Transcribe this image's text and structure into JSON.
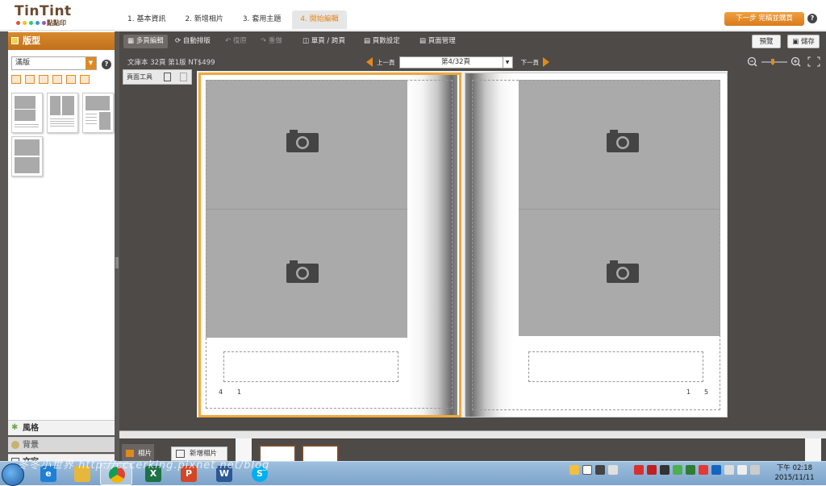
{
  "brand": {
    "name": "TinTint",
    "sub": "點點印",
    "dot_colors": [
      "#e74c3c",
      "#f1c40f",
      "#2ecc71",
      "#3498db",
      "#9b59b6"
    ]
  },
  "steps": [
    "1. 基本資訊",
    "2. 新增相片",
    "3. 套用主題",
    "4. 開始編輯"
  ],
  "active_step": 3,
  "next_button": "下一步 完稿並購買",
  "help": "?",
  "toolbar": {
    "multi_page": "多頁編輯",
    "auto_layout": "自動排版",
    "undo": "復原",
    "redo": "重做",
    "single_double": "單頁 / 跨頁",
    "page_settings": "頁數設定",
    "page_manage": "頁面管理",
    "preview": "預覽",
    "save": "儲存"
  },
  "sidebar": {
    "title": "版型",
    "dropdown_value": "滿版",
    "accordion": [
      "風格",
      "背景",
      "文字"
    ]
  },
  "workspace": {
    "info": "文庫本 32頁 第1版 NT$499",
    "prev": "上一頁",
    "next": "下一頁",
    "page_select": "第4/32頁",
    "page_tools": "頁面工具"
  },
  "pages": {
    "left_numbers": [
      "4",
      "1"
    ],
    "right_numbers": [
      "1",
      "5"
    ]
  },
  "filmstrip": {
    "photos_tab": "相片",
    "add_photo": "新增相片"
  },
  "taskbar": {
    "time": "下午 02:18",
    "date": "2015/11/11"
  },
  "watermark": "冬冬小世界 http://cccerking.pixnet.net/blog",
  "colors": {
    "accent": "#e08a1e",
    "workspace": "#4d4a47",
    "selection": "#f0a83a"
  }
}
